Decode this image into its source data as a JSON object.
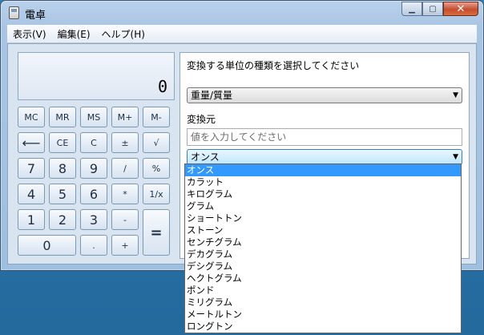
{
  "window": {
    "title": "電卓"
  },
  "menu": [
    "表示(V)",
    "編集(E)",
    "ヘルプ(H)"
  ],
  "display": {
    "value": "0"
  },
  "buttons": {
    "mc": "MC",
    "mr": "MR",
    "ms": "MS",
    "mplus": "M+",
    "mminus": "M-",
    "backspace": "⟵",
    "ce": "CE",
    "c": "C",
    "plusminus": "±",
    "sqrt": "√",
    "n7": "7",
    "n8": "8",
    "n9": "9",
    "div": "/",
    "pct": "%",
    "n4": "4",
    "n5": "5",
    "n6": "6",
    "mul": "*",
    "recip": "1/x",
    "n1": "1",
    "n2": "2",
    "n3": "3",
    "sub": "-",
    "eq": "=",
    "n0": "0",
    "dot": ".",
    "add": "+"
  },
  "converter": {
    "heading": "変換する単位の種類を選択してください",
    "unit_type": "重量/質量",
    "from_label": "変換元",
    "input_placeholder": "値を入力してください",
    "from_unit": "オンス",
    "options": [
      "オンス",
      "カラット",
      "キログラム",
      "グラム",
      "ショートトン",
      "ストーン",
      "センチグラム",
      "デカグラム",
      "デシグラム",
      "ヘクトグラム",
      "ポンド",
      "ミリグラム",
      "メートルトン",
      "ロングトン"
    ],
    "selected_index": 0
  }
}
